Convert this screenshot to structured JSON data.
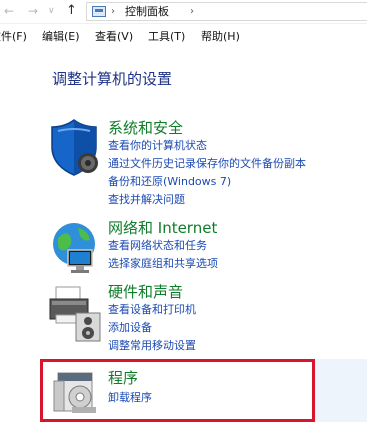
{
  "nav": {
    "back_glyph": "←",
    "forward_glyph": "→",
    "dropdown_glyph": "∨",
    "up_glyph": "↑",
    "separator": "›",
    "path": "控制面板"
  },
  "menu": [
    {
      "label": "文件(F)"
    },
    {
      "label": "编辑(E)"
    },
    {
      "label": "查看(V)"
    },
    {
      "label": "工具(T)"
    },
    {
      "label": "帮助(H)"
    }
  ],
  "heading": "调整计算机的设置",
  "categories": [
    {
      "icon": "shield-icon",
      "title": "系统和安全",
      "links": [
        "查看你的计算机状态",
        "通过文件历史记录保存你的文件备份副本",
        "备份和还原(Windows 7)",
        "查找并解决问题"
      ]
    },
    {
      "icon": "network-icon",
      "title": "网络和 Internet",
      "links": [
        "查看网络状态和任务",
        "选择家庭组和共享选项"
      ]
    },
    {
      "icon": "printer-icon",
      "title": "硬件和声音",
      "links": [
        "查看设备和打印机",
        "添加设备",
        "调整常用移动设置"
      ]
    },
    {
      "icon": "programs-icon",
      "title": "程序",
      "links": [
        "卸载程序"
      ]
    }
  ],
  "colors": {
    "category_title": "#0f7d2a",
    "link": "#1b4ab3",
    "heading": "#1e3287",
    "highlight_border": "#d8152d"
  }
}
